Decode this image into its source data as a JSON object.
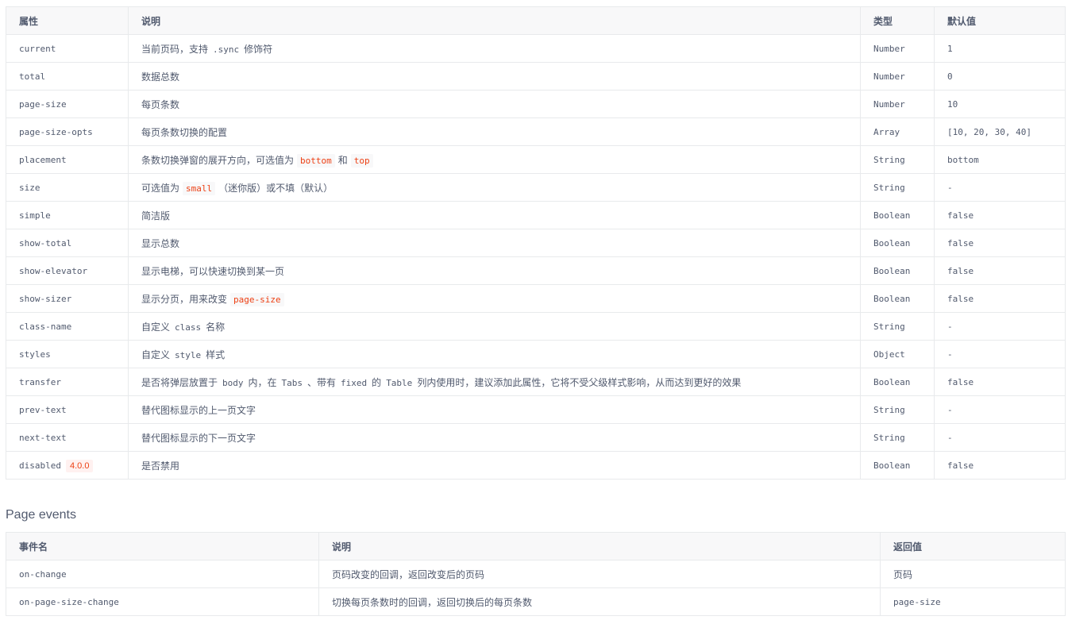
{
  "props_table": {
    "headers": {
      "attr": "属性",
      "desc": "说明",
      "type": "类型",
      "default": "默认值"
    },
    "rows": [
      {
        "name": "current",
        "desc_pre": "当前页码，支持",
        "desc_code": ".sync",
        "desc_post": "修饰符",
        "type": "Number",
        "default": "1"
      },
      {
        "name": "total",
        "desc": "数据总数",
        "type": "Number",
        "default": "0"
      },
      {
        "name": "page-size",
        "desc": "每页条数",
        "type": "Number",
        "default": "10"
      },
      {
        "name": "page-size-opts",
        "desc": "每页条数切换的配置",
        "type": "Array",
        "default": "[10, 20, 30, 40]"
      },
      {
        "name": "placement",
        "desc_pre": "条数切换弹窗的展开方向，可选值为",
        "desc_code1": "bottom",
        "desc_mid": "和",
        "desc_code2": "top",
        "type": "String",
        "default": "bottom"
      },
      {
        "name": "size",
        "desc_pre": "可选值为",
        "desc_code": "small",
        "desc_post": "（迷你版）或不填（默认）",
        "type": "String",
        "default": "-"
      },
      {
        "name": "simple",
        "desc": "简洁版",
        "type": "Boolean",
        "default": "false"
      },
      {
        "name": "show-total",
        "desc": "显示总数",
        "type": "Boolean",
        "default": "false"
      },
      {
        "name": "show-elevator",
        "desc": "显示电梯，可以快速切换到某一页",
        "type": "Boolean",
        "default": "false"
      },
      {
        "name": "show-sizer",
        "desc_pre": "显示分页，用来改变",
        "desc_code": "page-size",
        "type": "Boolean",
        "default": "false"
      },
      {
        "name": "class-name",
        "desc_pre": "自定义",
        "desc_code": "class",
        "desc_post": "名称",
        "type": "String",
        "default": "-"
      },
      {
        "name": "styles",
        "desc_pre": "自定义",
        "desc_code": "style",
        "desc_post": "样式",
        "type": "Object",
        "default": "-"
      },
      {
        "name": "transfer",
        "desc_parts": [
          "是否将弹层放置于",
          "body",
          "内，在",
          "Tabs",
          "、带有",
          "fixed",
          "的",
          "Table",
          "列内使用时，建议添加此属性，它将不受父级样式影响，从而达到更好的效果"
        ],
        "type": "Boolean",
        "default": "false"
      },
      {
        "name": "prev-text",
        "desc": "替代图标显示的上一页文字",
        "type": "String",
        "default": "-"
      },
      {
        "name": "next-text",
        "desc": "替代图标显示的下一页文字",
        "type": "String",
        "default": "-"
      },
      {
        "name": "disabled",
        "badge": "4.0.0",
        "desc": "是否禁用",
        "type": "Boolean",
        "default": "false"
      }
    ]
  },
  "events_heading": "Page events",
  "events_table": {
    "headers": {
      "event": "事件名",
      "desc": "说明",
      "return": "返回值"
    },
    "rows": [
      {
        "name": "on-change",
        "desc": "页码改变的回调，返回改变后的页码",
        "return": "页码"
      },
      {
        "name": "on-page-size-change",
        "desc": "切换每页条数时的回调，返回切换后的每页条数",
        "return": "page-size"
      }
    ]
  },
  "colors": {
    "text": "#515a6e",
    "header_bg": "#f8f8f9",
    "border": "#e8eaec",
    "code_red": "#ed4014"
  }
}
